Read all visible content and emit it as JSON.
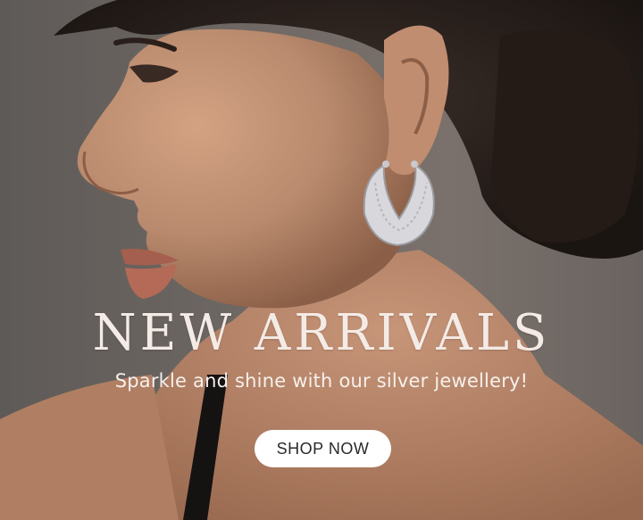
{
  "banner": {
    "headline": "NEW ARRIVALS",
    "subheadline": "Sparkle and shine with our silver jewellery!",
    "cta_label": "SHOP NOW"
  },
  "colors": {
    "background": "#6f6864",
    "skin": "#b98a6d",
    "hair": "#2a221f",
    "text": "#f4ebe6",
    "button_bg": "#ffffff",
    "button_text": "#2a2a2a"
  }
}
